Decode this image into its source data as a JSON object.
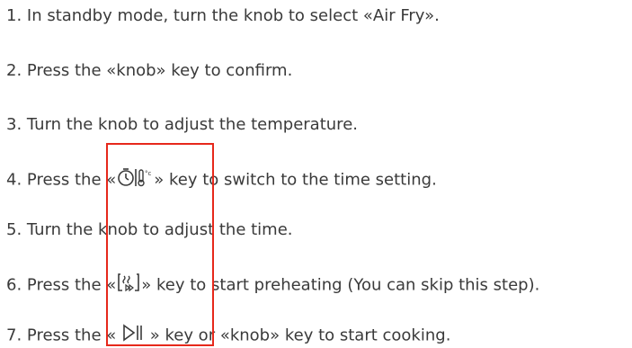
{
  "colors": {
    "text": "#3a3a3a",
    "highlight": "#e6281b"
  },
  "steps": [
    {
      "number": "1.",
      "text": "In standby mode, turn the knob to select «Air Fry»."
    },
    {
      "number": "2.",
      "text": "Press the «knob» key to confirm."
    },
    {
      "number": "3.",
      "text": "Turn the knob to adjust the temperature."
    },
    {
      "number": "4.",
      "before": "Press the «",
      "icon": "timer-thermometer-icon",
      "after": "» key to switch to the time setting."
    },
    {
      "number": "5.",
      "text": "Turn the knob to adjust the time."
    },
    {
      "number": "6.",
      "before": "Press the «",
      "icon": "preheat-icon",
      "after": "» key to start preheating (You can skip this step)."
    },
    {
      "number": "7.",
      "before": "Press the « ",
      "icon": "play-pause-icon",
      "after": " » key or «knob» key to start cooking."
    }
  ]
}
